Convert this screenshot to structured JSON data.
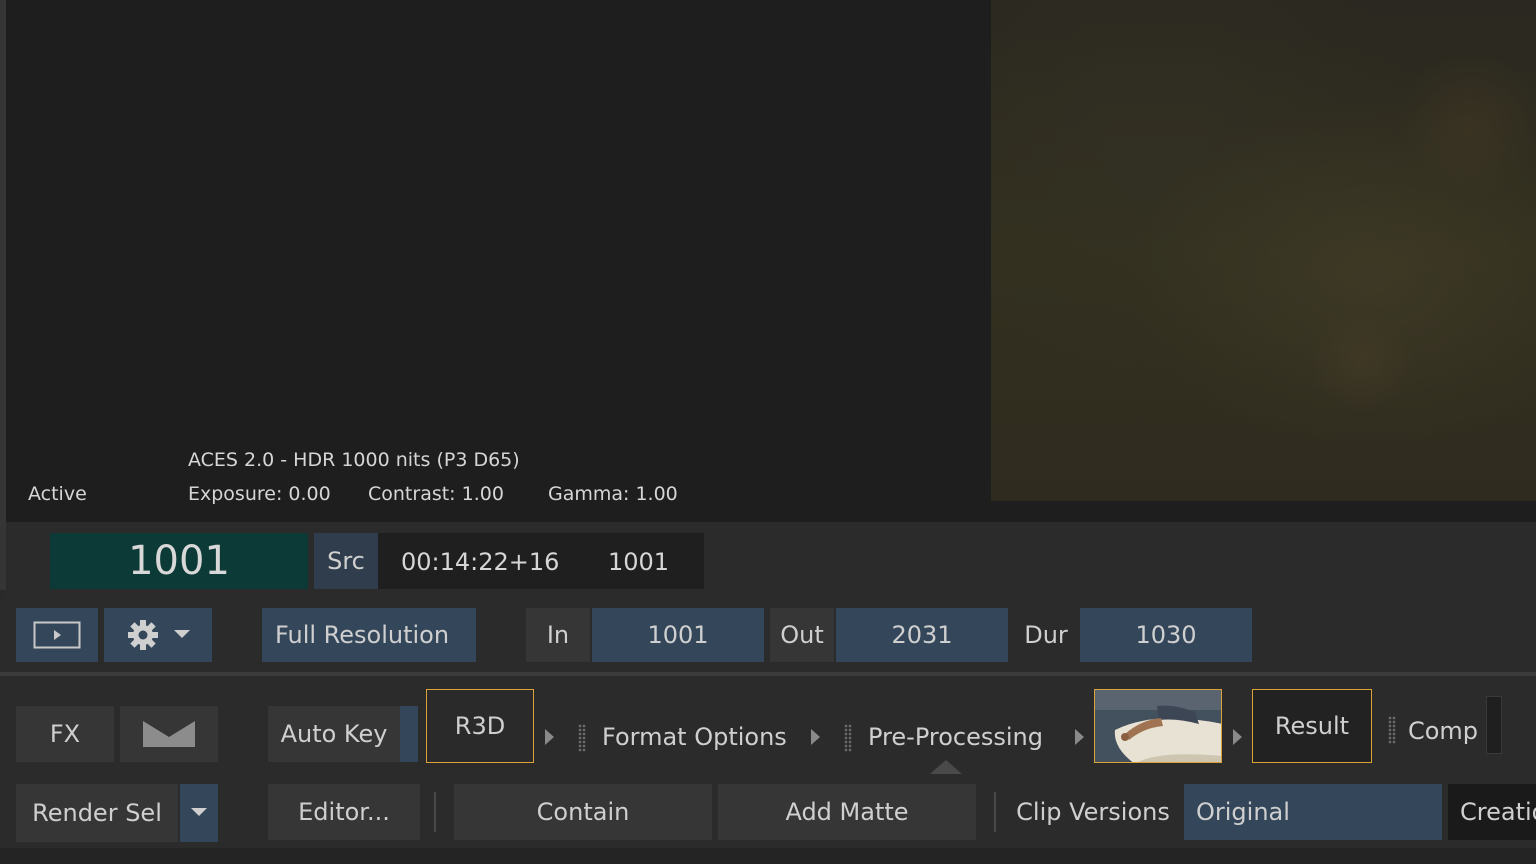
{
  "viewer": {
    "status": "Active",
    "view_transform": "ACES 2.0 - HDR 1000 nits (P3 D65)",
    "exposure": "Exposure: 0.00",
    "contrast": "Contrast: 1.00",
    "gamma": "Gamma: 1.00"
  },
  "timecode": {
    "frame": "1001",
    "src_label": "Src",
    "timecode": "00:14:22+16",
    "src_frame": "1001"
  },
  "controls": {
    "resolution": "Full Resolution",
    "in_label": "In",
    "in_value": "1001",
    "out_label": "Out",
    "out_value": "2031",
    "dur_label": "Dur",
    "dur_value": "1030"
  },
  "pipeline": {
    "fx_label": "FX",
    "auto_key": "Auto Key",
    "r3d": "R3D",
    "format_options": "Format Options",
    "pre_processing": "Pre-Processing",
    "result": "Result",
    "comp": "Comp"
  },
  "bottom": {
    "render_sel": "Render Sel",
    "editor": "Editor...",
    "contain": "Contain",
    "add_matte": "Add Matte",
    "clip_versions_label": "Clip Versions",
    "clip_version_value": "Original",
    "creation_partial": "Creatio"
  },
  "colors": {
    "frame_bg": "#0c3a36",
    "accent_blue": "#34475a",
    "highlight_border": "#d9a33a"
  }
}
